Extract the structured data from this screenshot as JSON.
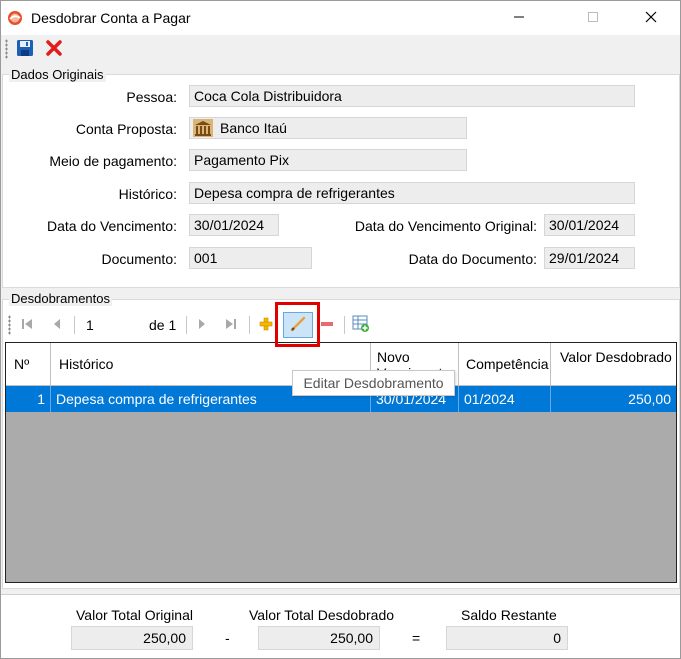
{
  "window": {
    "title": "Desdobrar Conta a Pagar",
    "icons": {
      "app": "app-logo-icon",
      "minimize": "minimize-icon",
      "maximize": "maximize-icon",
      "close": "close-icon"
    }
  },
  "toolbar": {
    "save_icon": "floppy-disk-icon",
    "cancel_icon": "red-x-icon"
  },
  "dados": {
    "legend": "Dados Originais",
    "pessoa_label": "Pessoa:",
    "pessoa_value": "Coca Cola Distribuidora",
    "conta_label": "Conta Proposta:",
    "conta_value": "Banco Itaú",
    "conta_icon": "bank-building-icon",
    "meio_label": "Meio de pagamento:",
    "meio_value": "Pagamento Pix",
    "historico_label": "Histórico:",
    "historico_value": "Depesa compra de refrigerantes",
    "venc_label": "Data do Vencimento:",
    "venc_value": "30/01/2024",
    "venc_orig_label": "Data do Vencimento Original:",
    "venc_orig_value": "30/01/2024",
    "doc_label": "Documento:",
    "doc_value": "001",
    "data_doc_label": "Data do Documento:",
    "data_doc_value": "29/01/2024"
  },
  "desdobramentos": {
    "legend": "Desdobramentos",
    "nav": {
      "current": "1",
      "of_label": "de 1"
    },
    "tooltip": "Editar Desdobramento",
    "columns": [
      "Nº",
      "Histórico",
      "Novo Vencimento",
      "Competência",
      "Valor Desdobrado"
    ],
    "rows": [
      {
        "num": "1",
        "historico": "Depesa compra de refrigerantes",
        "vencimento": "30/01/2024",
        "competencia": "01/2024",
        "valor": "250,00"
      }
    ]
  },
  "totals": {
    "original_label": "Valor Total Original",
    "original_value": "250,00",
    "minus": "-",
    "desdobrado_label": "Valor Total Desdobrado",
    "desdobrado_value": "250,00",
    "equals": "=",
    "saldo_label": "Saldo Restante",
    "saldo_value": "0"
  },
  "colors": {
    "selection": "#0078d7",
    "highlight_border": "#e00000",
    "grid_empty": "#ababab"
  }
}
